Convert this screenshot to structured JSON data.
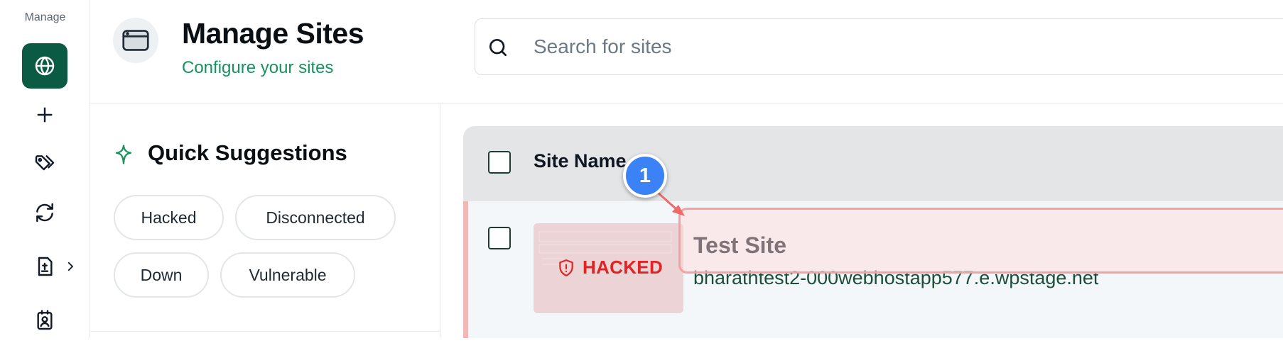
{
  "rail": {
    "label": "Manage",
    "items": [
      {
        "icon": "globe-icon",
        "active": true
      },
      {
        "icon": "plus-icon",
        "active": false
      },
      {
        "icon": "tags-icon",
        "active": false
      },
      {
        "icon": "sync-icon",
        "active": false
      },
      {
        "icon": "plugin-file-icon",
        "active": false,
        "has_submenu": true
      },
      {
        "icon": "contact-card-icon",
        "active": false
      }
    ]
  },
  "header": {
    "icon": "browser-window-icon",
    "title": "Manage Sites",
    "subtitle": "Configure your sites"
  },
  "search": {
    "placeholder": "Search for sites",
    "value": ""
  },
  "suggestions": {
    "title": "Quick Suggestions",
    "chips": [
      "Hacked",
      "Disconnected",
      "Down",
      "Vulnerable"
    ]
  },
  "table": {
    "column_header": "Site Name",
    "rows": [
      {
        "name": "Test Site",
        "url": "bharathtest2-000webhostapp577.e.wpstage.net",
        "status": "HACKED"
      }
    ]
  },
  "annotation": {
    "marker_number": "1"
  },
  "colors": {
    "accent": "#0b5a44",
    "subtitle_green": "#17915f",
    "hacked_red": "#e02424",
    "marker_blue": "#3b82f6",
    "highlight_border": "#f3a1a1"
  }
}
